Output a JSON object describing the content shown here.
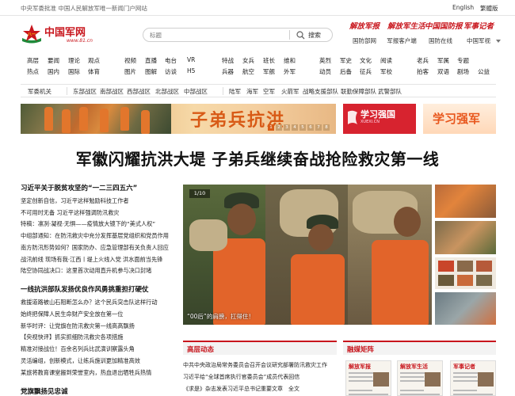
{
  "topbar": {
    "slogan": "中央军委批准 中国人民解放军唯一新闻门户网站",
    "lang_en": "English",
    "lang_trad": "繁體版"
  },
  "logo": {
    "title": "中国军网",
    "url": "www.81.cn"
  },
  "search": {
    "placeholder": "标题",
    "button": "搜索"
  },
  "mastheads": [
    "解放军报",
    "解放军生活",
    "中国国防报",
    "军事记者"
  ],
  "channels": [
    "国防部网",
    "军报客户端",
    "国防在线",
    "中国军视"
  ],
  "nav_rows": [
    [
      "高层",
      "要闻",
      "理论",
      "观点",
      "视频",
      "直播",
      "电台",
      "VR",
      "特战",
      "女兵",
      "班长",
      "维和",
      "英烈",
      "军史",
      "文化",
      "阅读",
      "老兵",
      "军属",
      "专题"
    ],
    [
      "热点",
      "国内",
      "国际",
      "体育",
      "图片",
      "图解",
      "访谈",
      "H5",
      "兵器",
      "航空",
      "军舰",
      "外军",
      "动员",
      "后备",
      "征兵",
      "军校",
      "拍客",
      "双语",
      "剧场",
      "公益"
    ]
  ],
  "region_bar": [
    "军委机关",
    "东部战区",
    "南部战区",
    "西部战区",
    "北部战区",
    "中部战区",
    "陆军",
    "海军",
    "空军",
    "火箭军",
    "战略支援部队",
    "联勤保障部队",
    "武警部队"
  ],
  "banner": {
    "main_text": "子弟兵抗洪",
    "pages": [
      "1",
      "2",
      "3",
      "4",
      "5",
      "6",
      "7",
      "8"
    ],
    "xuexi_title": "学习强国",
    "xuexi_url": "XUEXI.CN",
    "qiangjun_title": "学习强军"
  },
  "headline": "军徽闪耀抗洪大堤 子弟兵继续奋战抢险救灾第一线",
  "left_column": {
    "section1_title": "习近平关于脱贫攻坚的“一二三四五六”",
    "section1_items": [
      "坚定创新自信，习近平这样勉励科技工作者",
      "不可用时无备 习近平这样强调防汛救灾",
      "特稿：凛冽·凝视·无惧——疫情放大镜下的“美式人权”",
      "中组部通知：在防汛救灾中充分发挥基层党组织和党员作用",
      "南方防汛形势如何？国家防办、应急管理部有关负责人回应",
      "战汛前线 现场有我·江西丨堤上火线入党 洪水面前当先锋",
      "陆空协同战决口：这里首次动用直升机参与决口封堵"
    ],
    "section2_title": "一线抗洪部队发扬优良作风勇挑重担打硬仗",
    "section2_items": [
      "救援道路被山石阻断怎么办？这个民兵突击队这样行动",
      "始终把保障人民生命财产安全放在第一位",
      "新华时评：让党旗在防汛救灾第一线高高飘扬",
      "【央视快评】抓实抓细防汛救灾各项措施",
      "精准对接战位！百余名列兵比武演训察露头角",
      "灵活编组，创新模式，让练兵施训更加精准高效",
      "某旅将教育课堂搬到荣誉室内，热血退出牺牲兵热情"
    ],
    "section3_title": "党旗飘扬见忠诚"
  },
  "photo": {
    "counter": "1/10",
    "caption": "“00后”的肩膀，扛得住！"
  },
  "gaoceng": {
    "tab_label": "高层动态",
    "items": [
      "中共中央政治局常务委员会召开会议研究部署防汛救灾工作",
      "习近平给“全球首席执行官委员会”成员代表回信",
      "《求是》杂志发表习近平总书记重要文章　全文"
    ]
  },
  "rongmei": {
    "tab_label": "融媒矩阵",
    "papers": [
      "解放军报",
      "解放军生活",
      "军事记者"
    ]
  },
  "colors": {
    "brand_red": "#c8161d",
    "banner_orange": "#d85a16",
    "vest_orange": "#e2642a"
  }
}
